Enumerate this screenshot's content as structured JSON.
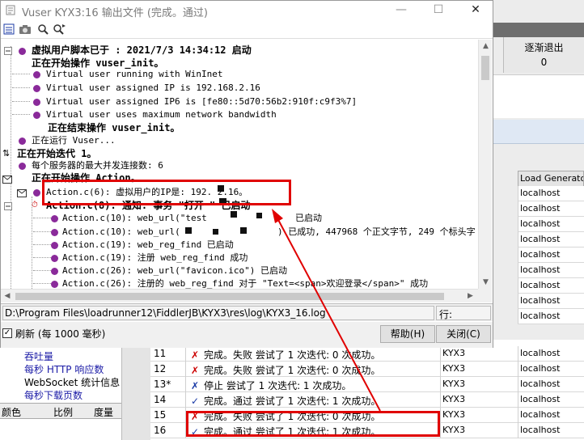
{
  "window": {
    "title": "Vuser KYX3:16 输出文件 (完成。通过)",
    "min_label": "—",
    "max_label": "☐",
    "close_label": "✕"
  },
  "toolbar": [
    "list-icon",
    "camera-icon",
    "find-icon",
    "find-next-icon"
  ],
  "log": {
    "l0": "虚拟用户脚本已于 : 2021/7/3 14:34:12 启动",
    "l1": "正在开始操作 vuser_init。",
    "l2": "Virtual user running with WinInet",
    "l3": "Virtual user assigned IP is 192.168.2.16",
    "l4": "Virtual user assigned IP6 is [fe80::5d70:56b2:910f:c9f3%7]",
    "l5": "Virtual user uses maximum network bandwidth",
    "l6": "正在结束操作 vuser_init。",
    "l7": "正在运行 Vuser...",
    "l8": "正在开始迭代 1。",
    "l9": "每个服务器的最大并发连接数: 6",
    "l10": "正在开始操作 Action。",
    "l11": "Action.c(6): 虚拟用户的IP是: 192.  2.16。",
    "l12": "Action.c(8): 通知: 事务 \"打开  \" 已启动",
    "l13a": "Action.c(10): web_url(\"test",
    "l13b": "已启动",
    "l14a": "Action.c(10): web_url(",
    "l14b": ") 已成功, 447968 个正文字节, 249 个标头字",
    "l15": "Action.c(19): web_reg_find 已启动",
    "l16": "Action.c(19): 注册 web_reg_find 成功",
    "l17": "Action.c(26): web_url(\"favicon.ico\") 已启动",
    "l18": "Action.c(26): 注册的 web_reg_find 对于 \"Text=<span>欢迎登录</span>\" 成功"
  },
  "status": {
    "path": "D:\\Program Files\\loadrunner12\\FiddlerJB\\KYX3\\res\\log\\KYX3_16.log",
    "line_label": "行:"
  },
  "footer": {
    "refresh_mark": "✓",
    "refresh_label": "刷新 (每 1000 毫秒)",
    "help": "帮助(H)",
    "close": "关闭(C)"
  },
  "background": {
    "exit_header": "逐渐退出",
    "exit_value": "0",
    "lg_header": "Load Generator",
    "lg_rows": [
      "localhost",
      "localhost",
      "localhost",
      "localhost",
      "localhost",
      "localhost",
      "localhost",
      "localhost",
      "localhost"
    ],
    "left_items": [
      "吞吐量",
      "每秒 HTTP 响应数",
      "WebSocket 统计信息",
      "每秒下载页数"
    ],
    "left_cols": [
      "颜色",
      "比例",
      "度量"
    ],
    "rows": [
      {
        "num": "11",
        "status": "完成。失败  尝试了 1 次迭代: 0 次成功。",
        "script": "KYX3",
        "host": "localhost",
        "icon": "✗"
      },
      {
        "num": "12",
        "status": "完成。失败  尝试了 1 次迭代: 0 次成功。",
        "script": "KYX3",
        "host": "localhost",
        "icon": "✗"
      },
      {
        "num": "13*",
        "status": "停止  尝试了 1 次迭代: 1 次成功。",
        "script": "KYX3",
        "host": "localhost",
        "icon": "✗"
      },
      {
        "num": "14",
        "status": "完成。通过  尝试了 1 次迭代: 1 次成功。",
        "script": "KYX3",
        "host": "localhost",
        "icon": "✓"
      },
      {
        "num": "15",
        "status": "完成。失败  尝试了 1 次迭代: 0 次成功。",
        "script": "KYX3",
        "host": "localhost",
        "icon": "✗"
      },
      {
        "num": "16",
        "status": "完成。通过  尝试了 1 次迭代: 1 次成功。",
        "script": "KYX3",
        "host": "localhost",
        "icon": "✓"
      }
    ]
  },
  "colors": {
    "annotation": "#e00000",
    "log_marker": "#8a2a9a"
  }
}
